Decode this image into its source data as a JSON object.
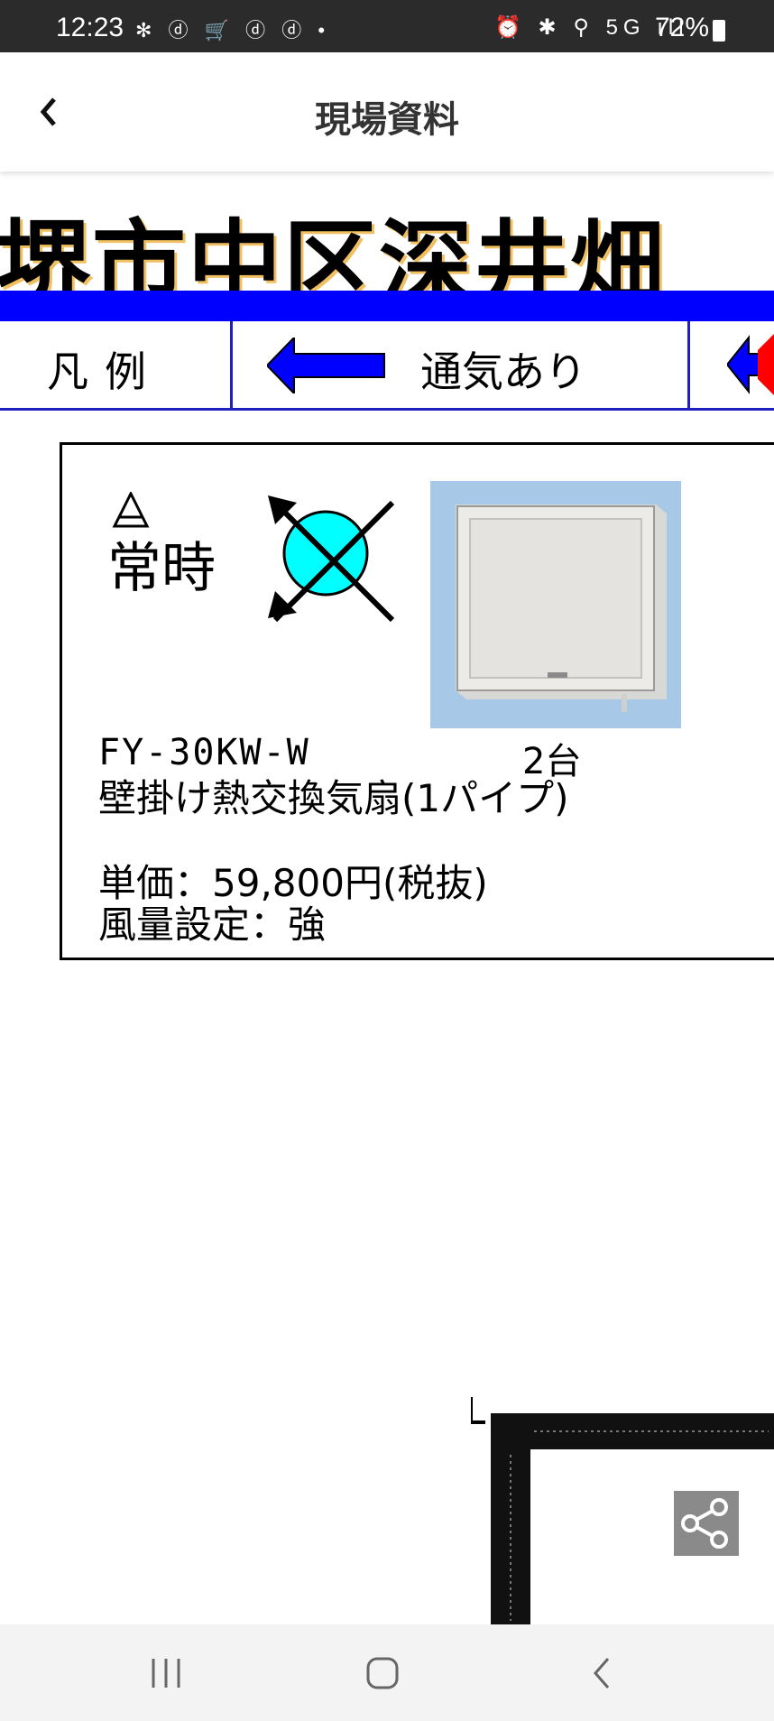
{
  "status_bar": {
    "time": "12:23",
    "left_icons": "✻ ⓓ 🛒 ⓓ ⓓ •",
    "right_icons": "⏰ ✱ ⚲ 5G ıll",
    "battery": "72%"
  },
  "header": {
    "title": "現場資料",
    "back_icon": "chevron-left-icon"
  },
  "document": {
    "title": "堺市中区深井畑",
    "legend": {
      "label": "凡例",
      "item_text": "通気あり",
      "arrow_color": "#0000ff",
      "secondary_color": "#ff0000"
    },
    "product": {
      "operation_mode": "常時",
      "model": "FY-30KW-W",
      "quantity": "2台",
      "name": "壁掛け熱交換気扇(1パイプ)",
      "price": "単価：59,800円(税抜)",
      "airflow": "風量設定：強",
      "symbol_color": "#00ffff"
    }
  },
  "share_icon": "share-icon",
  "nav": {
    "recents_icon": "recents-icon",
    "home_icon": "home-icon",
    "back_icon": "back-icon"
  }
}
